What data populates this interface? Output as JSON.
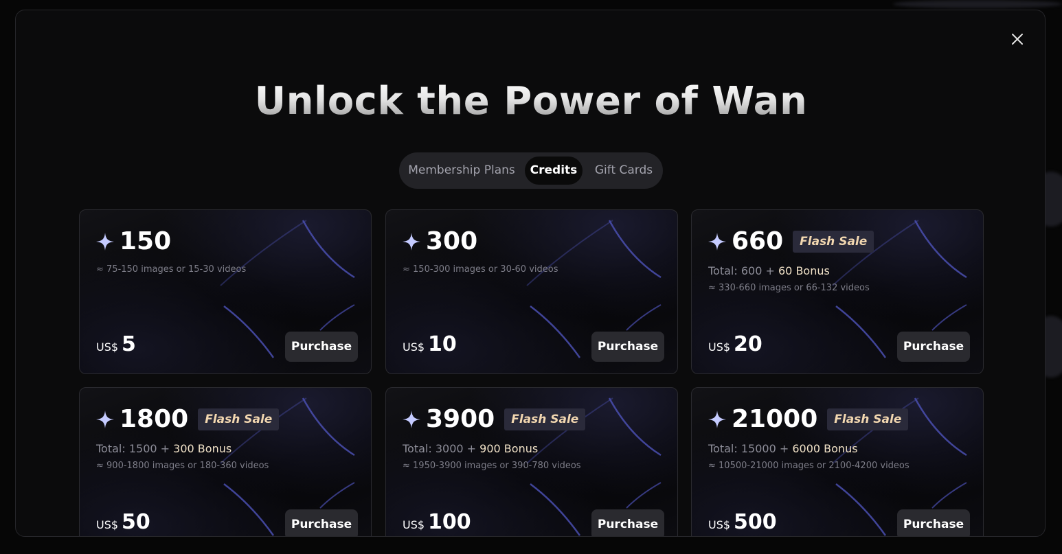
{
  "title": "Unlock the Power of Wan",
  "tabs": [
    {
      "label": "Membership Plans",
      "active": false
    },
    {
      "label": "Credits",
      "active": true
    },
    {
      "label": "Gift Cards",
      "active": false
    }
  ],
  "icons": {
    "close": "close-icon",
    "credit": "sparkle-icon"
  },
  "colors": {
    "background": "#0b0b0c",
    "card_border": "#2a2a2f",
    "button": "#2a2a2f",
    "flash_sale_text": "#f2d7b0",
    "bonus_text": "#f1e2c8",
    "sparkle": "#c5cbff",
    "arc": "#4a4fb0"
  },
  "packages": [
    {
      "credits": "150",
      "flash_sale": "",
      "total_prefix": "",
      "total_base": "",
      "total_plus": "",
      "bonus": "",
      "description": "≈ 75-150 images or 15-30 videos",
      "currency": "US$",
      "price": "5",
      "button": "Purchase"
    },
    {
      "credits": "300",
      "flash_sale": "",
      "total_prefix": "",
      "total_base": "",
      "total_plus": "",
      "bonus": "",
      "description": "≈ 150-300 images or 30-60 videos",
      "currency": "US$",
      "price": "10",
      "button": "Purchase"
    },
    {
      "credits": "660",
      "flash_sale": "Flash Sale",
      "total_prefix": "Total:",
      "total_base": "600",
      "total_plus": "+",
      "bonus": "60 Bonus",
      "description": "≈ 330-660 images or 66-132 videos",
      "currency": "US$",
      "price": "20",
      "button": "Purchase"
    },
    {
      "credits": "1800",
      "flash_sale": "Flash Sale",
      "total_prefix": "Total:",
      "total_base": "1500",
      "total_plus": "+",
      "bonus": "300 Bonus",
      "description": "≈ 900-1800 images or 180-360 videos",
      "currency": "US$",
      "price": "50",
      "button": "Purchase"
    },
    {
      "credits": "3900",
      "flash_sale": "Flash Sale",
      "total_prefix": "Total:",
      "total_base": "3000",
      "total_plus": "+",
      "bonus": "900 Bonus",
      "description": "≈ 1950-3900 images or 390-780 videos",
      "currency": "US$",
      "price": "100",
      "button": "Purchase"
    },
    {
      "credits": "21000",
      "flash_sale": "Flash Sale",
      "total_prefix": "Total:",
      "total_base": "15000",
      "total_plus": "+",
      "bonus": "6000 Bonus",
      "description": "≈ 10500-21000 images or 2100-4200 videos",
      "currency": "US$",
      "price": "500",
      "button": "Purchase"
    }
  ]
}
